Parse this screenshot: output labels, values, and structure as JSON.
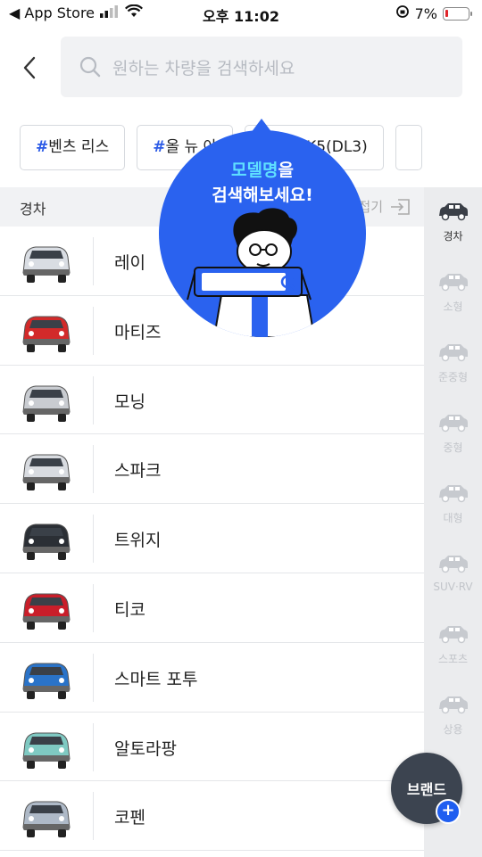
{
  "status_bar": {
    "back_app": "◀ App Store",
    "time": "오후 11:02",
    "battery": "7%"
  },
  "search": {
    "placeholder": "원하는 차량을 검색하세요"
  },
  "tags": [
    {
      "hash": "#",
      "label": "벤츠 리스"
    },
    {
      "hash": "#",
      "label": "올 뉴 아"
    },
    {
      "hash": "#",
      "label": "신형 K5(DL3)"
    }
  ],
  "list_header": {
    "category": "경차",
    "fold_label": "접기"
  },
  "cars": [
    {
      "name": "레이",
      "color": "#d9dde3"
    },
    {
      "name": "마티즈",
      "color": "#d22a2a"
    },
    {
      "name": "모닝",
      "color": "#c9ccd1"
    },
    {
      "name": "스파크",
      "color": "#d8dbe0"
    },
    {
      "name": "트위지",
      "color": "#2b2f35"
    },
    {
      "name": "티코",
      "color": "#c91e2a"
    },
    {
      "name": "스마트 포투",
      "color": "#2a73c8"
    },
    {
      "name": "알토라팡",
      "color": "#7fc9c2"
    },
    {
      "name": "코펜",
      "color": "#aeb9c7"
    }
  ],
  "side_categories": [
    {
      "label": "경차",
      "active": true
    },
    {
      "label": "소형",
      "active": false
    },
    {
      "label": "준중형",
      "active": false
    },
    {
      "label": "중형",
      "active": false
    },
    {
      "label": "대형",
      "active": false
    },
    {
      "label": "SUV·RV",
      "active": false
    },
    {
      "label": "스포츠",
      "active": false
    },
    {
      "label": "상용",
      "active": false
    }
  ],
  "tooltip": {
    "highlight": "모델명",
    "after_highlight": "을",
    "line2": "검색해보세요!"
  },
  "fab": {
    "label": "브랜드",
    "plus": "+"
  },
  "colors": {
    "accent": "#2a62ef",
    "hash": "#2c5be6",
    "highlight": "#5fe0ff"
  }
}
